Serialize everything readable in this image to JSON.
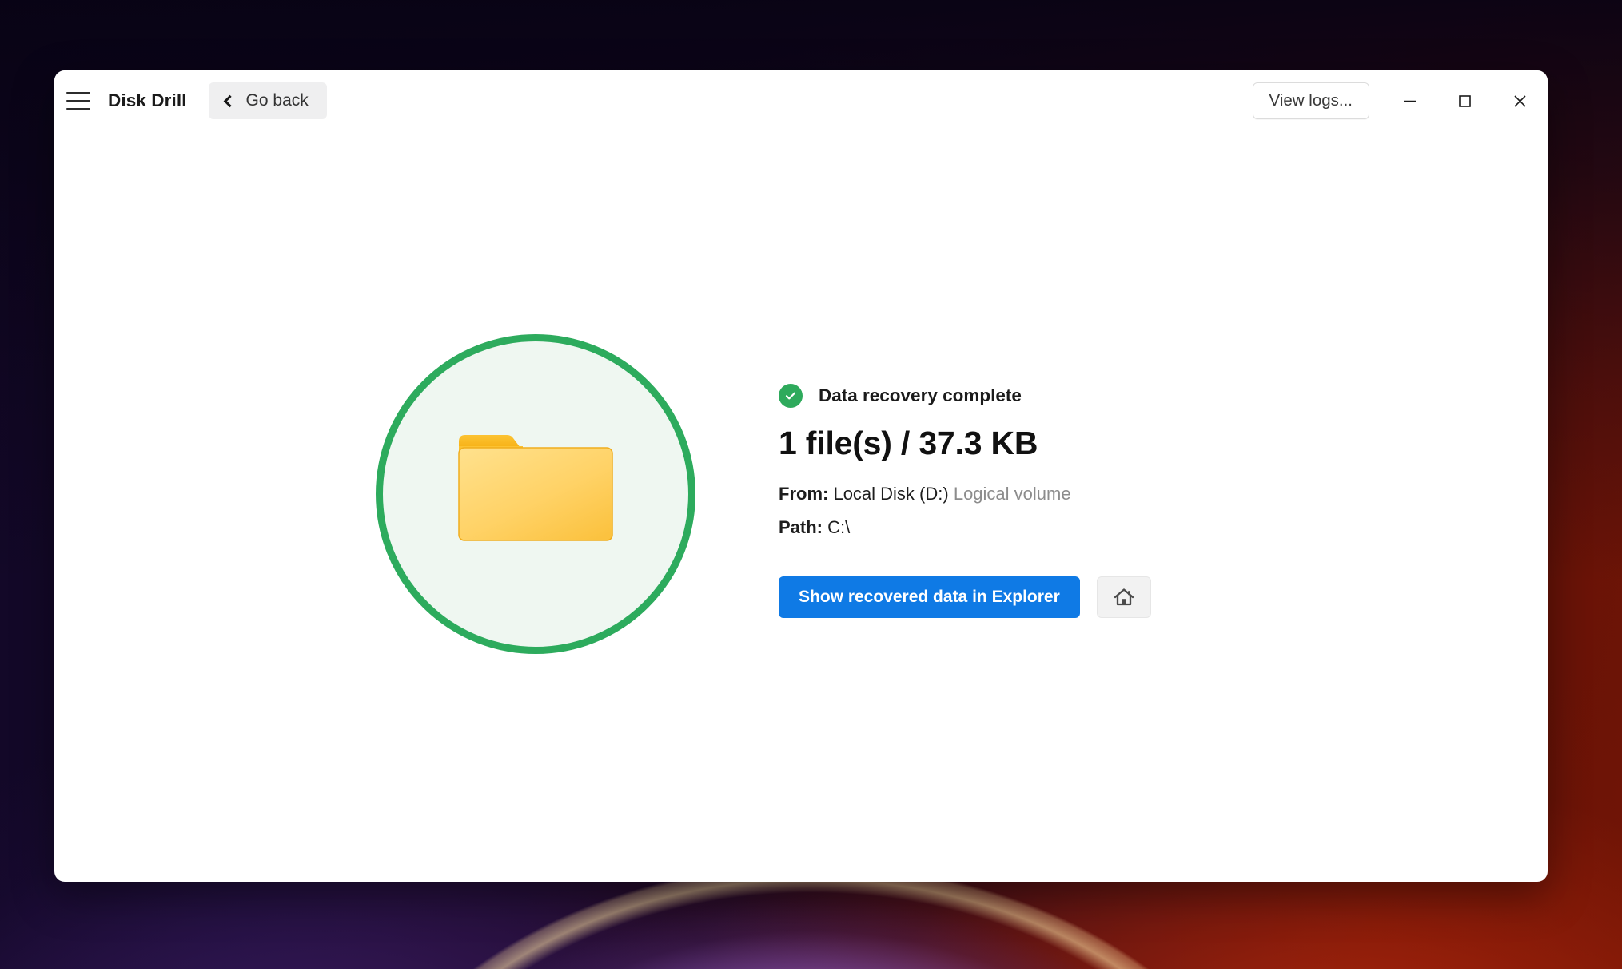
{
  "window": {
    "app_title": "Disk Drill",
    "menu_icon": "hamburger-menu-icon",
    "go_back_label": "Go back",
    "go_back_icon": "chevron-left-icon",
    "view_logs_label": "View logs...",
    "controls": {
      "minimize": "minimize-icon",
      "maximize": "maximize-icon",
      "close": "close-icon"
    }
  },
  "main": {
    "illustration": {
      "icon": "folder-icon",
      "ring_color": "#2dab5d",
      "circle_fill": "#eff7f1",
      "folder_color": "#fbc02d"
    },
    "status": {
      "icon": "check-circle-icon",
      "icon_color": "#2eaa5c",
      "text": "Data recovery complete"
    },
    "headline": "1 file(s) / 37.3 KB",
    "details": [
      {
        "label": "From:",
        "value": "Local Disk (D:)",
        "suffix": "Logical volume"
      },
      {
        "label": "Path:",
        "value": "C:\\",
        "suffix": ""
      }
    ],
    "actions": {
      "primary_label": "Show recovered data in Explorer",
      "primary_color": "#0f7ae5",
      "home_icon": "home-icon"
    }
  }
}
